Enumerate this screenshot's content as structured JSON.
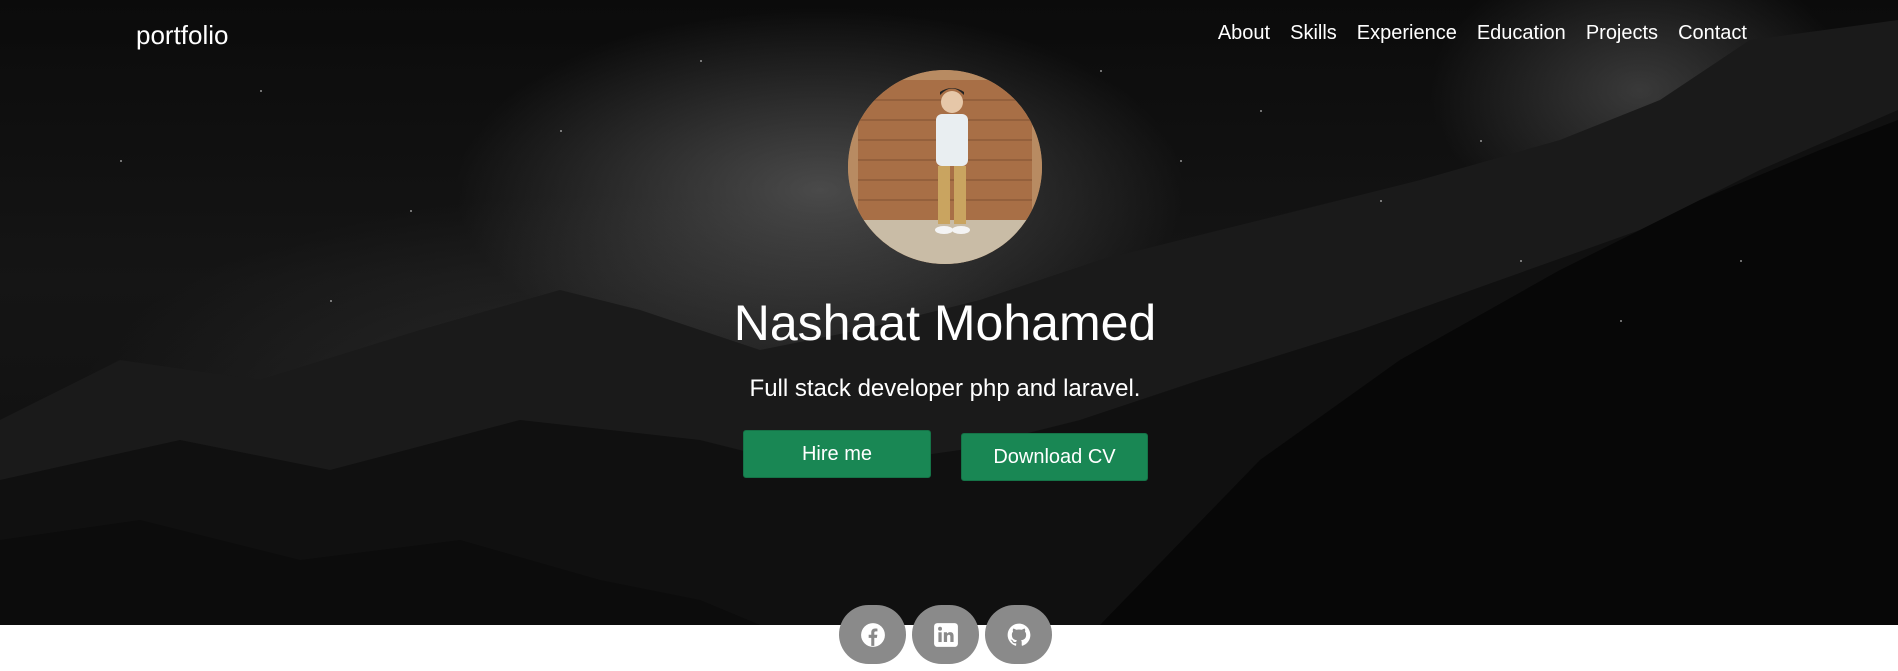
{
  "navbar": {
    "brand": "portfolio",
    "links": [
      "About",
      "Skills",
      "Experience",
      "Education",
      "Projects",
      "Contact"
    ]
  },
  "hero": {
    "name": "Nashaat Mohamed",
    "tagline": "Full stack developer php and laravel.",
    "hire_label": "Hire me",
    "cv_label": "Download CV"
  },
  "social": {
    "icons": [
      "facebook-icon",
      "linkedin-icon",
      "github-icon"
    ]
  },
  "colors": {
    "button": "#198754",
    "social_bg": "#8a8a8a",
    "hero_bg": "#111111"
  }
}
